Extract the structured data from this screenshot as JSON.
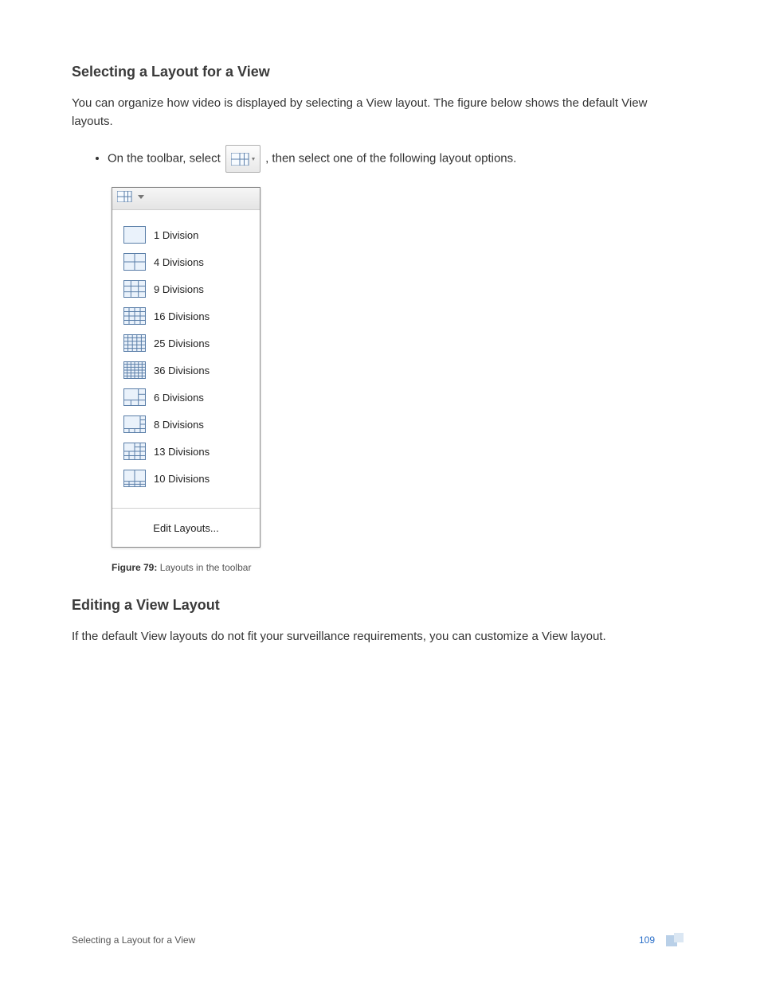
{
  "section1": {
    "heading": "Selecting a Layout for a View",
    "intro": "You can organize how video is displayed by selecting a View layout. The figure below shows the default View layouts.",
    "bullet_pre": "On the toolbar, select ",
    "bullet_post": ", then select one of the following layout options."
  },
  "dropdown": {
    "items": [
      {
        "label": "1 Division",
        "rows": 1,
        "cols": 1,
        "type": "uniform"
      },
      {
        "label": "4 Divisions",
        "rows": 2,
        "cols": 2,
        "type": "uniform"
      },
      {
        "label": "9 Divisions",
        "rows": 3,
        "cols": 3,
        "type": "uniform"
      },
      {
        "label": "16 Divisions",
        "rows": 4,
        "cols": 4,
        "type": "uniform"
      },
      {
        "label": "25 Divisions",
        "rows": 5,
        "cols": 5,
        "type": "uniform"
      },
      {
        "label": "36 Divisions",
        "rows": 6,
        "cols": 6,
        "type": "uniform"
      },
      {
        "label": "6 Divisions",
        "type": "preset6"
      },
      {
        "label": "8 Divisions",
        "type": "preset8"
      },
      {
        "label": "13 Divisions",
        "type": "preset13"
      },
      {
        "label": "10 Divisions",
        "type": "preset10"
      }
    ],
    "edit_label": "Edit Layouts..."
  },
  "figure": {
    "label_bold": "Figure 79:",
    "label_rest": " Layouts in the toolbar"
  },
  "section2": {
    "heading": "Editing a View Layout",
    "intro": "If the default View layouts do not fit your surveillance requirements, you can customize a View layout."
  },
  "footer": {
    "left": "Selecting a Layout for a View",
    "page_number": "109"
  }
}
